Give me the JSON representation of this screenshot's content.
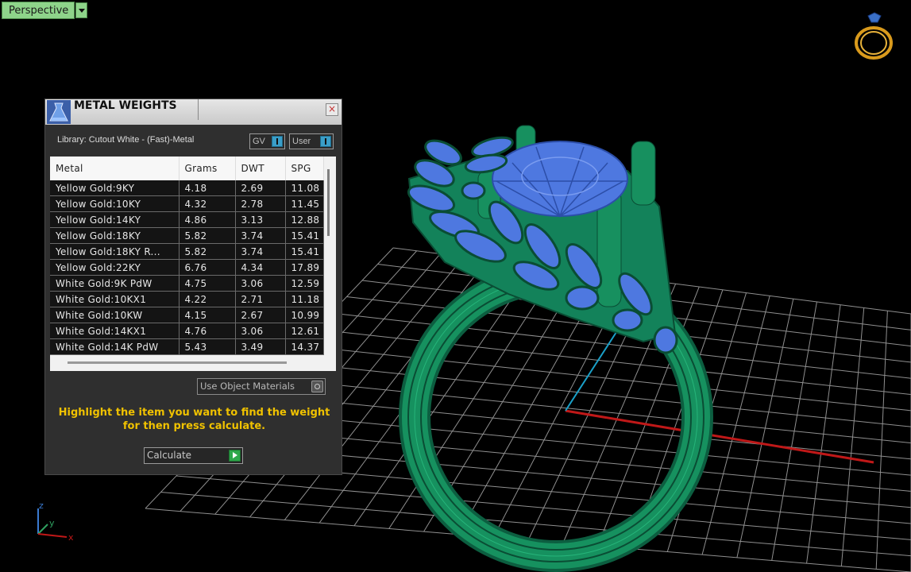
{
  "viewport": {
    "view_label": "Perspective",
    "axis_labels": {
      "x": "x",
      "y": "y",
      "z": "z"
    }
  },
  "panel": {
    "title": "METAL WEIGHTS",
    "close_label": "×",
    "library_label": "Library: Cutout White - (Fast)-Metal",
    "toggles": {
      "gv": "GV",
      "user": "User"
    },
    "columns": [
      "Metal",
      "Grams",
      "DWT",
      "SPG"
    ],
    "rows": [
      {
        "metal": "Yellow Gold:9KY",
        "grams": "4.18",
        "dwt": "2.69",
        "spg": "11.08"
      },
      {
        "metal": "Yellow Gold:10KY",
        "grams": "4.32",
        "dwt": "2.78",
        "spg": "11.45"
      },
      {
        "metal": "Yellow Gold:14KY",
        "grams": "4.86",
        "dwt": "3.13",
        "spg": "12.88"
      },
      {
        "metal": "Yellow Gold:18KY",
        "grams": "5.82",
        "dwt": "3.74",
        "spg": "15.41"
      },
      {
        "metal": "Yellow Gold:18KY R...",
        "grams": "5.82",
        "dwt": "3.74",
        "spg": "15.41"
      },
      {
        "metal": "Yellow Gold:22KY",
        "grams": "6.76",
        "dwt": "4.34",
        "spg": "17.89"
      },
      {
        "metal": "White Gold:9K PdW",
        "grams": "4.75",
        "dwt": "3.06",
        "spg": "12.59"
      },
      {
        "metal": "White Gold:10KX1",
        "grams": "4.22",
        "dwt": "2.71",
        "spg": "11.18"
      },
      {
        "metal": "White Gold:10KW",
        "grams": "4.15",
        "dwt": "2.67",
        "spg": "10.99"
      },
      {
        "metal": "White Gold:14KX1",
        "grams": "4.76",
        "dwt": "3.06",
        "spg": "12.61"
      },
      {
        "metal": "White Gold:14K PdW",
        "grams": "5.43",
        "dwt": "3.49",
        "spg": "14.37"
      }
    ],
    "use_object_materials_label": "Use Object Materials",
    "instructions": "Highlight the item you want to find the weight for then press calculate.",
    "calculate_label": "Calculate"
  },
  "colors": {
    "ring": "#13825a",
    "gems": "#4e78e0",
    "grid": "#9a9a9a",
    "axis_x": "#c01818",
    "axis_y": "#1aa0c8",
    "instruction_text": "#f0c200",
    "view_tab": "#8ed48a"
  }
}
